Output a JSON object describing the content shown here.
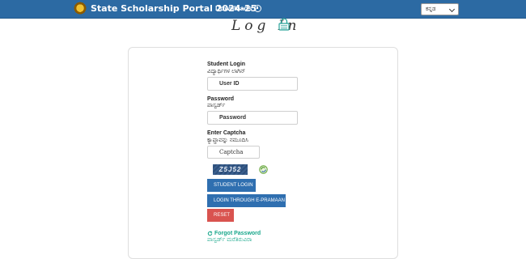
{
  "header": {
    "brand": "State Scholarship Portal 2024-25",
    "downloads_label": "Downloads",
    "language_selected": "ಕನ್ನಡ"
  },
  "page": {
    "title": "Log In"
  },
  "form": {
    "student_login_label": "Student Login",
    "student_login_kn": "ವಿದ್ಯಾರ್ಥಿಗಳ ಲಾಗಿನ್",
    "user_id_placeholder": "User ID",
    "password_label": "Password",
    "password_kn": "ಪಾಸ್ವರ್ಡ್",
    "password_placeholder": "Password",
    "captcha_label": "Enter Captcha",
    "captcha_kn": "ಕ್ಯಾಪ್ಚಾವನ್ನು ನಮೂದಿಸಿ",
    "captcha_placeholder": "Captcha",
    "captcha_code": "Z5J52",
    "student_login_button": "STUDENT LOGIN",
    "epramaan_button": "LOGIN THROUGH E-PRAMAAN",
    "reset_button": "RESET",
    "forgot_password": "Forgot Password",
    "forgot_password_kn": "ಪಾಸ್ವರ್ಡ್ ಮರೆತಿರುವಿರಾ"
  },
  "colors": {
    "header_bg": "#2c6aa3",
    "primary_button": "#2f6fb0",
    "reset_button": "#d9534f",
    "link": "#17a68a"
  },
  "icons": [
    "emblem-icon",
    "download-icon",
    "lock-icon",
    "refresh-icon",
    "forgot-icon"
  ]
}
